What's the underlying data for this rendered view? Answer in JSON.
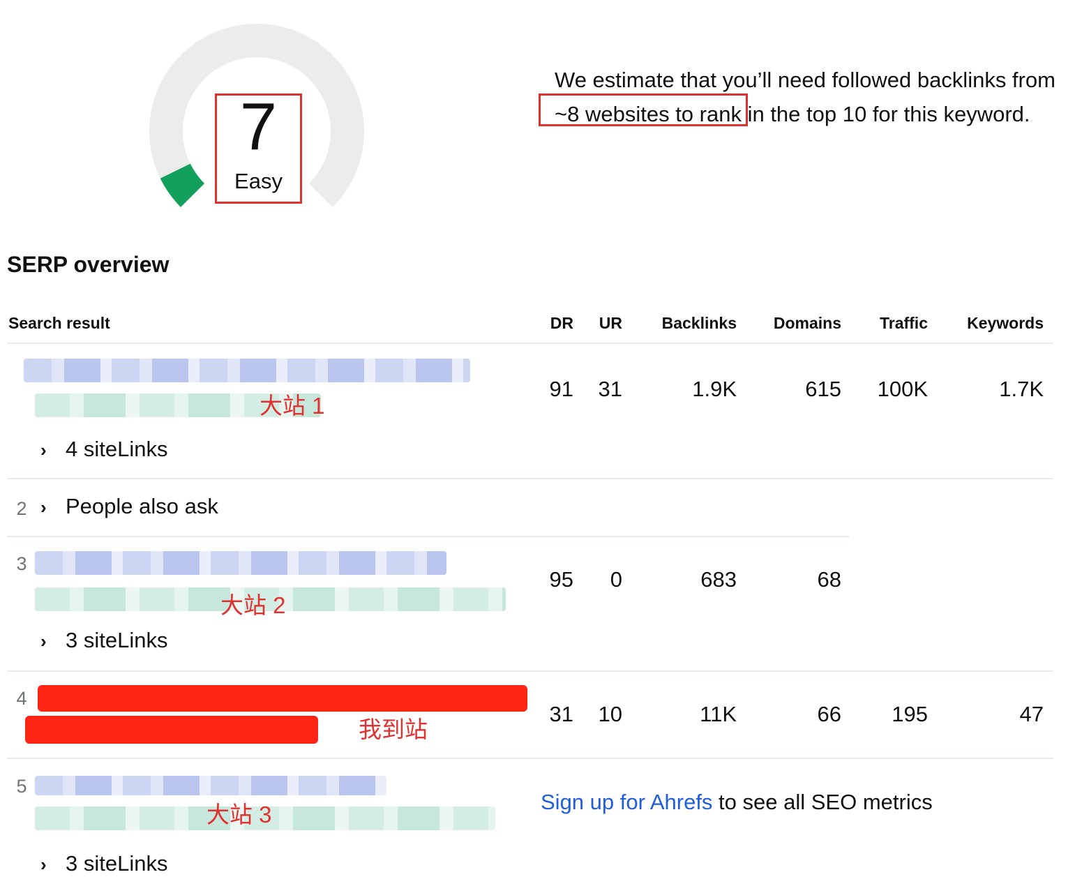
{
  "gauge": {
    "value": "7",
    "label": "Easy",
    "score_fraction": 0.07,
    "track_color": "#ececec",
    "fill_color": "#12a05c"
  },
  "estimate": {
    "text_before": "We estimate that you’ll need followed backlinks from ",
    "highlight": "~8 websites",
    "text_after": " to rank in the top 10 for this keyword."
  },
  "serp": {
    "title": "SERP overview",
    "columns": {
      "search_result": "Search result",
      "dr": "DR",
      "ur": "UR",
      "backlinks": "Backlinks",
      "domains": "Domains",
      "traffic": "Traffic",
      "keywords": "Keywords"
    },
    "rows": [
      {
        "position": "",
        "annotation": "大站 1",
        "dr": "91",
        "ur": "31",
        "backlinks": "1.9K",
        "domains": "615",
        "traffic": "100K",
        "keywords": "1.7K",
        "sitelinks": "4 siteLinks"
      },
      {
        "position": "2",
        "label": "People also ask"
      },
      {
        "position": "3",
        "annotation": "大站 2",
        "dr": "95",
        "ur": "0",
        "backlinks": "683",
        "domains": "68",
        "sitelinks": "3 siteLinks"
      },
      {
        "position": "4",
        "annotation": "我到站",
        "dr": "31",
        "ur": "10",
        "backlinks": "11K",
        "domains": "66",
        "traffic": "195",
        "keywords": "47"
      },
      {
        "position": "5",
        "annotation": "大站 3",
        "sitelinks": "3 siteLinks"
      }
    ],
    "signup": {
      "link_text": "Sign up for Ahrefs",
      "rest_text": " to see all SEO metrics"
    }
  },
  "colors": {
    "annotation_red": "#e03131",
    "redaction_red": "#ff2414",
    "link_blue": "#1f5ed8",
    "row_number_gray": "#6f7479"
  }
}
